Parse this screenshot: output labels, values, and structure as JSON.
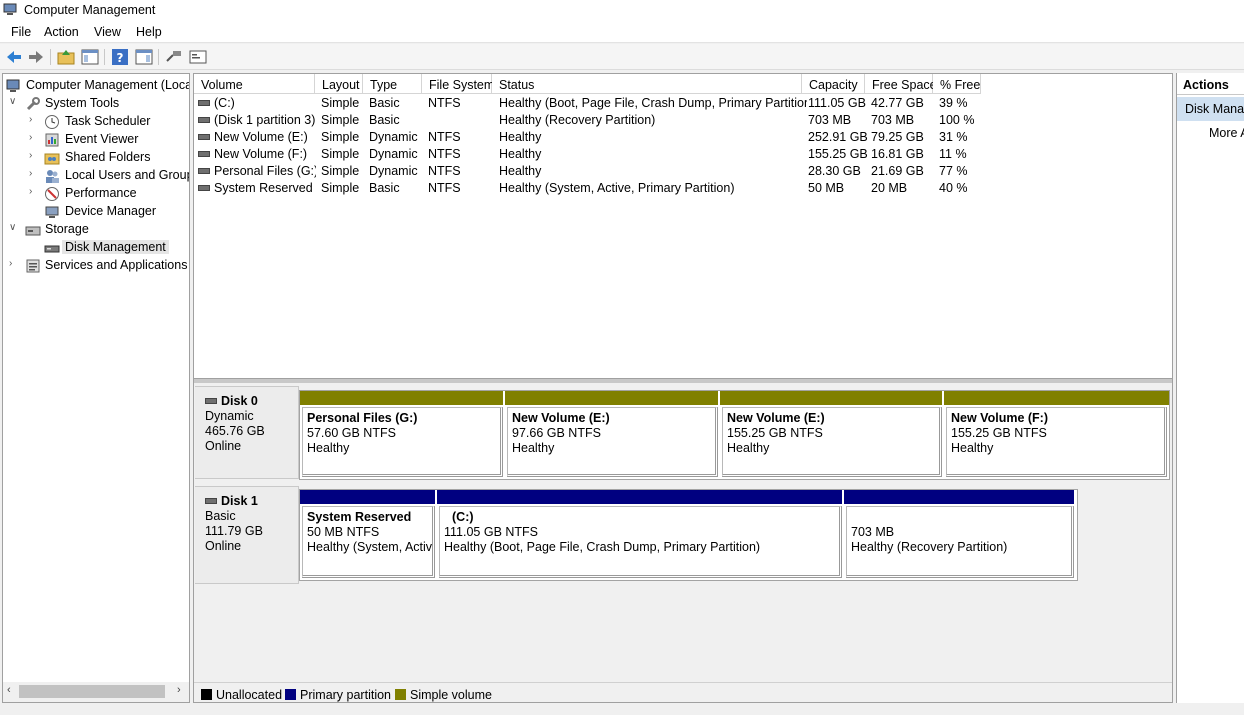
{
  "window": {
    "title": "Computer Management"
  },
  "menu": [
    "File",
    "Action",
    "View",
    "Help"
  ],
  "tree": {
    "root": "Computer Management (Local",
    "items": [
      {
        "label": "System Tools",
        "icon": "tools-icon"
      },
      {
        "label": "Task Scheduler",
        "icon": "clock-icon"
      },
      {
        "label": "Event Viewer",
        "icon": "event-viewer-icon"
      },
      {
        "label": "Shared Folders",
        "icon": "shared-folder-icon"
      },
      {
        "label": "Local Users and Groups",
        "icon": "users-icon"
      },
      {
        "label": "Performance",
        "icon": "performance-icon"
      },
      {
        "label": "Device Manager",
        "icon": "device-manager-icon"
      },
      {
        "label": "Storage",
        "icon": "storage-icon"
      },
      {
        "label": "Disk Management",
        "icon": "disk-icon"
      },
      {
        "label": "Services and Applications",
        "icon": "services-icon"
      }
    ]
  },
  "volume_list": {
    "columns": [
      "Volume",
      "Layout",
      "Type",
      "File System",
      "Status",
      "Capacity",
      "Free Space",
      "% Free"
    ],
    "rows": [
      [
        "(C:)",
        "Simple",
        "Basic",
        "NTFS",
        "Healthy (Boot, Page File, Crash Dump, Primary Partition)",
        "111.05 GB",
        "42.77 GB",
        "39 %"
      ],
      [
        "(Disk 1 partition 3)",
        "Simple",
        "Basic",
        "",
        "Healthy (Recovery Partition)",
        "703 MB",
        "703 MB",
        "100 %"
      ],
      [
        "New Volume (E:)",
        "Simple",
        "Dynamic",
        "NTFS",
        "Healthy",
        "252.91 GB",
        "79.25 GB",
        "31 %"
      ],
      [
        "New Volume (F:)",
        "Simple",
        "Dynamic",
        "NTFS",
        "Healthy",
        "155.25 GB",
        "16.81 GB",
        "11 %"
      ],
      [
        "Personal Files (G:)",
        "Simple",
        "Dynamic",
        "NTFS",
        "Healthy",
        "28.30 GB",
        "21.69 GB",
        "77 %"
      ],
      [
        "System Reserved",
        "Simple",
        "Basic",
        "NTFS",
        "Healthy (System, Active, Primary Partition)",
        "50 MB",
        "20 MB",
        "40 %"
      ]
    ]
  },
  "disks": [
    {
      "name": "Disk 0",
      "type": "Dynamic",
      "size": "465.76 GB",
      "status": "Online",
      "partitions": [
        {
          "name": "Personal Files  (G:)",
          "size": "57.60 GB NTFS",
          "status": "Healthy",
          "kind": "simple"
        },
        {
          "name": "New Volume  (E:)",
          "size": "97.66 GB NTFS",
          "status": "Healthy",
          "kind": "simple"
        },
        {
          "name": "New Volume  (E:)",
          "size": "155.25 GB NTFS",
          "status": "Healthy",
          "kind": "simple"
        },
        {
          "name": "New Volume  (F:)",
          "size": "155.25 GB NTFS",
          "status": "Healthy",
          "kind": "simple"
        }
      ]
    },
    {
      "name": "Disk 1",
      "type": "Basic",
      "size": "111.79 GB",
      "status": "Online",
      "partitions": [
        {
          "name": "System Reserved",
          "size": "50 MB NTFS",
          "status": "Healthy (System, Active",
          "kind": "primary"
        },
        {
          "name": "(C:)",
          "size": "111.05 GB NTFS",
          "status": "Healthy (Boot, Page File, Crash Dump, Primary Partition)",
          "kind": "primary"
        },
        {
          "name": "",
          "size": "703 MB",
          "status": "Healthy (Recovery Partition)",
          "kind": "primary"
        }
      ]
    }
  ],
  "legend": [
    {
      "label": "Unallocated",
      "color": "#000000"
    },
    {
      "label": "Primary partition",
      "color": "#000080"
    },
    {
      "label": "Simple volume",
      "color": "#808000"
    }
  ],
  "actions": {
    "header": "Actions",
    "section": "Disk Manag",
    "more": "More A"
  }
}
